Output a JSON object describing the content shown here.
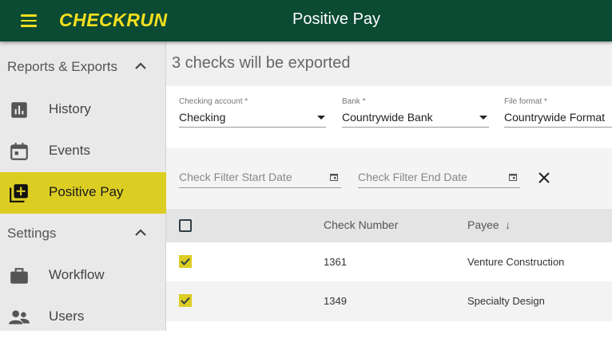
{
  "header": {
    "app_name": "CHECKRUN",
    "title": "Positive Pay"
  },
  "colors": {
    "topbar": "#0b4a33",
    "brand_yellow": "#f4e01f",
    "active_item": "#dccd23"
  },
  "sidebar": {
    "sections": [
      {
        "label": "Reports & Exports",
        "items": [
          {
            "label": "History",
            "icon": "bar-chart-icon"
          },
          {
            "label": "Events",
            "icon": "calendar-icon"
          },
          {
            "label": "Positive Pay",
            "icon": "library-add-icon",
            "active": true
          }
        ]
      },
      {
        "label": "Settings",
        "items": [
          {
            "label": "Workflow",
            "icon": "briefcase-icon"
          },
          {
            "label": "Users",
            "icon": "people-icon"
          }
        ]
      }
    ]
  },
  "main": {
    "headline": "3 checks will be exported",
    "fields": {
      "account": {
        "label": "Checking account *",
        "value": "Checking"
      },
      "bank": {
        "label": "Bank *",
        "value": "Countrywide Bank"
      },
      "format": {
        "label": "File format *",
        "value": "Countrywide Format"
      }
    },
    "filters": {
      "start_placeholder": "Check Filter Start Date",
      "end_placeholder": "Check Filter End Date"
    },
    "table": {
      "columns": [
        "Check Number",
        "Payee"
      ],
      "sort_indicator": "↓",
      "rows": [
        {
          "check_number": "1361",
          "payee": "Venture Construction",
          "checked": true
        },
        {
          "check_number": "1349",
          "payee": "Specialty Design",
          "checked": true
        }
      ]
    }
  }
}
